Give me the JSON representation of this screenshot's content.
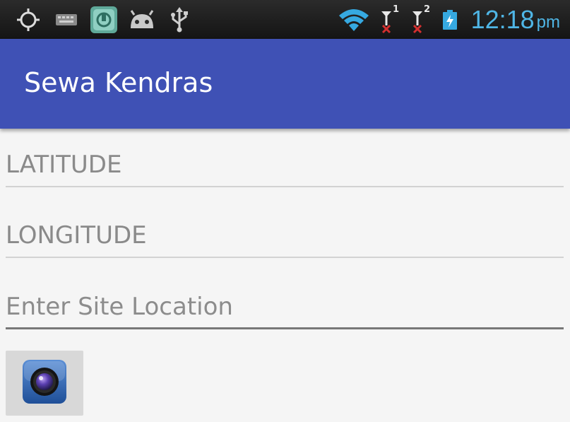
{
  "status_bar": {
    "time": "12:18",
    "time_suffix": "pm",
    "sim1_label": "1",
    "sim2_label": "2",
    "icons": [
      "gps-icon",
      "keyboard-icon",
      "app-notification-icon",
      "android-debug-icon",
      "usb-icon",
      "wifi-icon",
      "signal-sim1-icon",
      "signal-sim2-icon",
      "battery-charging-icon"
    ],
    "time_color": "#4fb6e6"
  },
  "app_bar": {
    "title": "Sewa Kendras",
    "color": "#3f51b5"
  },
  "form": {
    "latitude": {
      "value": "LATITUDE"
    },
    "longitude": {
      "value": "LONGITUDE"
    },
    "site_location": {
      "placeholder": "Enter Site Location",
      "value": ""
    }
  },
  "camera_button": {
    "icon": "camera-icon"
  }
}
